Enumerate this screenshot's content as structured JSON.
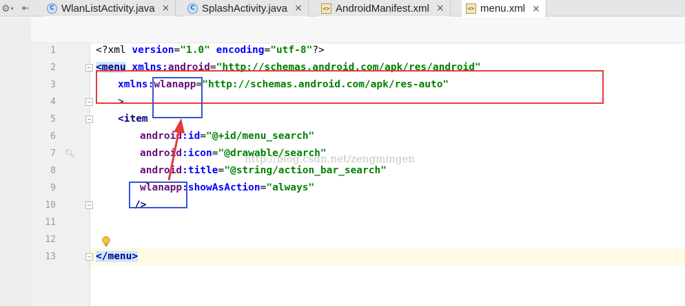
{
  "tabs": [
    {
      "label": "WlanListActivity.java",
      "icon": "c-class-icon",
      "active": false
    },
    {
      "label": "SplashActivity.java",
      "icon": "c-class-icon",
      "active": false
    },
    {
      "label": "AndroidManifest.xml",
      "icon": "xml-file-icon",
      "active": false
    },
    {
      "label": "menu.xml",
      "icon": "xml-file-icon",
      "active": true
    }
  ],
  "tab_close_glyph": "×",
  "toolbar": {
    "gear_glyph": "⚙",
    "caret_glyph": "▾",
    "pin_glyph": "⇤"
  },
  "line_numbers": [
    "1",
    "2",
    "3",
    "4",
    "5",
    "6",
    "7",
    "8",
    "9",
    "10",
    "11",
    "12",
    "13"
  ],
  "code": {
    "l1": {
      "a": "<?xml ",
      "b": "version",
      "c": "=",
      "d": "\"1.0\"",
      "e": " ",
      "f": "encoding",
      "g": "=",
      "h": "\"utf-8\"",
      "i": "?>"
    },
    "l2": {
      "a": "<menu",
      "b": " ",
      "c": "xmlns:",
      "d": "android",
      "e": "=",
      "f": "\"http://schemas.android.com/apk/res/android\""
    },
    "l3": {
      "a": "xmlns:",
      "b": "wlanapp",
      "c": "=",
      "d": "\"http://schemas.android.com/apk/res-auto\""
    },
    "l4": {
      "a": ">"
    },
    "l5": {
      "a": "<item"
    },
    "l6": {
      "a": "android",
      "b": ":id",
      "c": "=",
      "d": "\"@+id/menu_search\""
    },
    "l7": {
      "a": "android",
      "b": ":icon",
      "c": "=",
      "d": "\"@drawable/search\""
    },
    "l8": {
      "a": "android",
      "b": ":title",
      "c": "=",
      "d": "\"@string/action_bar_search\""
    },
    "l9": {
      "a": "wlanapp",
      "b": ":showAsAction",
      "c": "=",
      "d": "\"always\""
    },
    "l10": {
      "a": "/>"
    },
    "l13": {
      "a": "</menu",
      "b": ">"
    }
  },
  "watermark": "http://blog.csdn.net/zengmingen",
  "colors": {
    "annotation_red": "#e53935",
    "annotation_blue": "#3355cc",
    "arrow_red": "#e53935",
    "tag": "#000080",
    "attr": "#0000ff",
    "namespace": "#660e7a",
    "value": "#008000"
  }
}
